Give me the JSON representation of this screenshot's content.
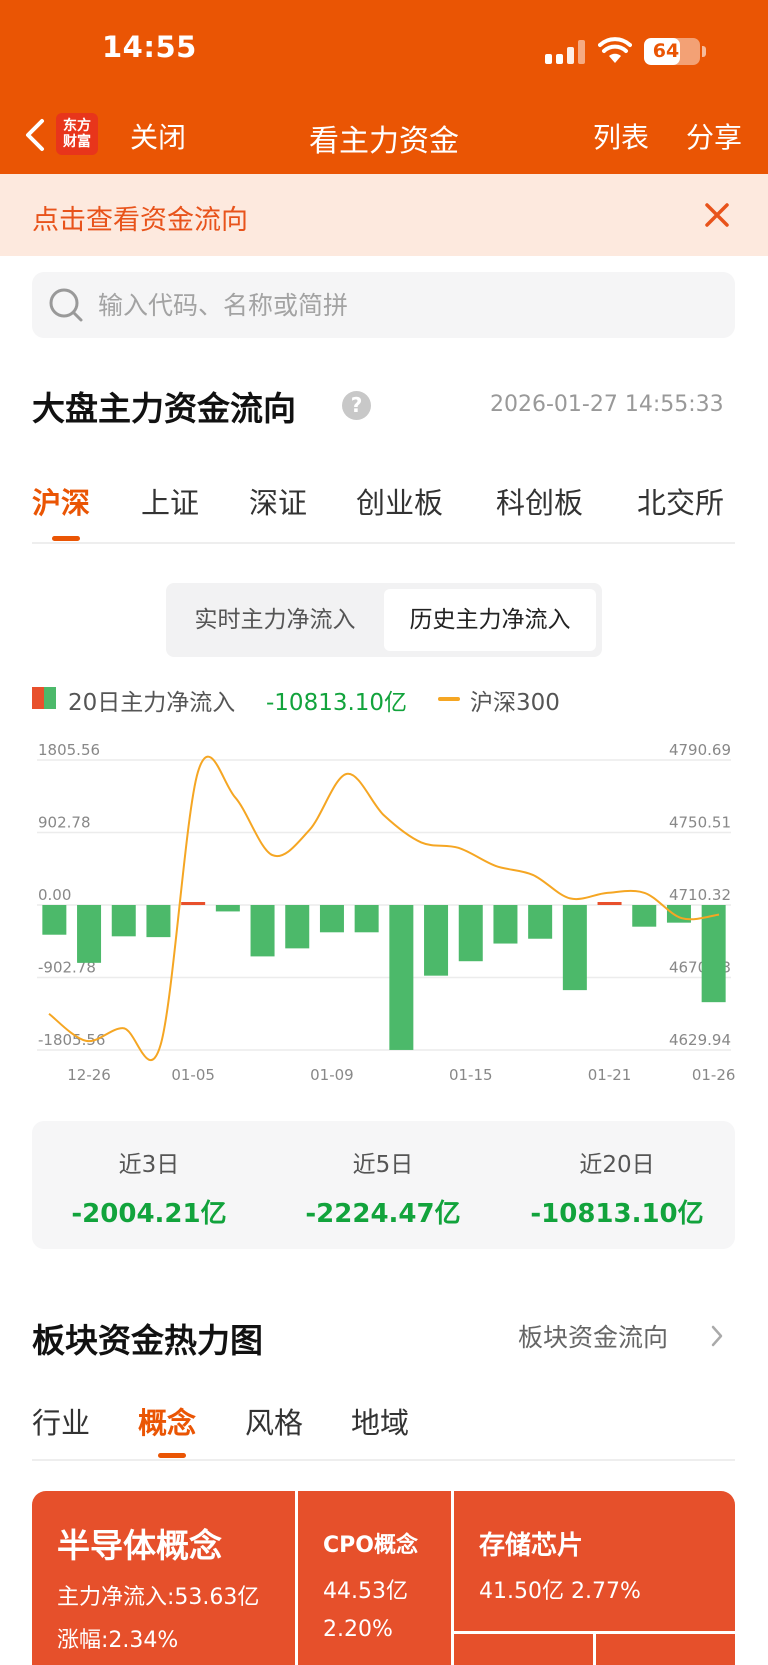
{
  "status_bar": {
    "time": "14:55",
    "battery": "64",
    "battery_level": 0.64
  },
  "nav": {
    "logo_line1": "东方",
    "logo_line2": "财富",
    "close": "关闭",
    "title": "看主力资金",
    "list": "列表",
    "share": "分享"
  },
  "notice": {
    "text": "点击查看资金流向"
  },
  "search": {
    "placeholder": "输入代码、名称或简拼"
  },
  "market": {
    "title": "大盘主力资金流向",
    "help": "?",
    "timestamp": "2026-01-27 14:55:33",
    "tabs": [
      "沪深",
      "上证",
      "深证",
      "创业板",
      "科创板",
      "北交所"
    ],
    "active_tab": 0,
    "segments": [
      "实时主力净流入",
      "历史主力净流入"
    ],
    "active_segment": 1,
    "legend": {
      "bar_label": "20日主力净流入",
      "bar_value": "-10813.10亿",
      "line_label": "沪深300"
    },
    "summary": [
      {
        "label": "近3日",
        "value": "-2004.21亿"
      },
      {
        "label": "近5日",
        "value": "-2224.47亿"
      },
      {
        "label": "近20日",
        "value": "-10813.10亿"
      }
    ]
  },
  "colors": {
    "brand": "#ea5504",
    "inflow": "#e8502c",
    "outflow": "#4cb96a",
    "index_line": "#f5a623",
    "tile": "#e6502b"
  },
  "chart_data": {
    "type": "bar",
    "left_axis": {
      "ticks": [
        "1805.56",
        "902.78",
        "0.00",
        "-902.78",
        "-1805.56"
      ],
      "range": [
        -1805.56,
        1805.56
      ]
    },
    "right_axis": {
      "ticks": [
        "4790.69",
        "4750.51",
        "4710.32",
        "4670.13",
        "4629.94"
      ],
      "range": [
        4629.94,
        4790.69
      ]
    },
    "x_tick_labels": [
      {
        "index": 1,
        "label": "12-26"
      },
      {
        "index": 4,
        "label": "01-05"
      },
      {
        "index": 8,
        "label": "01-09"
      },
      {
        "index": 12,
        "label": "01-15"
      },
      {
        "index": 16,
        "label": "01-21"
      },
      {
        "index": 19,
        "label": "01-26"
      }
    ],
    "series": [
      {
        "name": "20日主力净流入",
        "kind": "bar",
        "values": [
          -370,
          -720,
          -390,
          -400,
          30,
          -80,
          -640,
          -540,
          -340,
          -340,
          -1805,
          -880,
          -700,
          -480,
          -420,
          -1060,
          30,
          -270,
          -220,
          -1210
        ]
      },
      {
        "name": "沪深300",
        "kind": "line",
        "values": [
          4650,
          4635,
          4642,
          4633,
          4784,
          4770,
          4738,
          4752,
          4783,
          4760,
          4745,
          4742,
          4732,
          4727,
          4714,
          4717,
          4717,
          4703,
          4705
        ]
      }
    ]
  },
  "heatmap": {
    "title": "板块资金热力图",
    "link": "板块资金流向",
    "tabs": [
      "行业",
      "概念",
      "风格",
      "地域"
    ],
    "active_tab": 1,
    "tiles": [
      {
        "name": "半导体概念",
        "line1": "主力净流入:53.63亿",
        "line2": "涨幅:2.34%"
      },
      {
        "name": "CPO概念",
        "line1": "44.53亿",
        "line2": "2.20%"
      },
      {
        "name": "存储芯片",
        "line1": "41.50亿  2.77%",
        "line2": ""
      }
    ]
  }
}
